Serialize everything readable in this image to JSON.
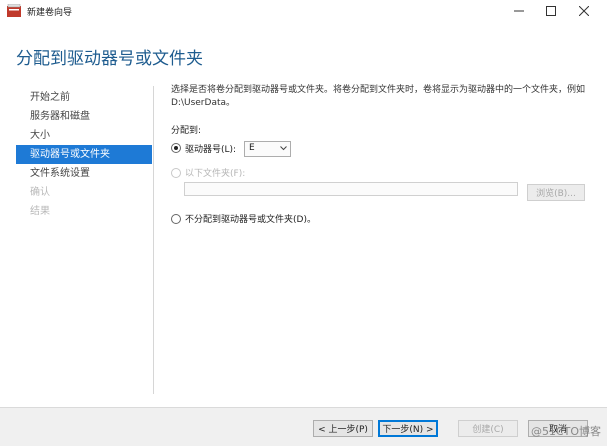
{
  "window": {
    "title": "新建卷向导",
    "controls": [
      "minimize-icon",
      "maximize-icon",
      "close-icon"
    ]
  },
  "heading": "分配到驱动器号或文件夹",
  "nav": {
    "items": [
      {
        "label": "开始之前",
        "state": "normal"
      },
      {
        "label": "服务器和磁盘",
        "state": "normal"
      },
      {
        "label": "大小",
        "state": "normal"
      },
      {
        "label": "驱动器号或文件夹",
        "state": "active"
      },
      {
        "label": "文件系统设置",
        "state": "normal"
      },
      {
        "label": "确认",
        "state": "disabled"
      },
      {
        "label": "结果",
        "state": "disabled"
      }
    ]
  },
  "main": {
    "description": "选择是否将卷分配到驱动器号或文件夹。将卷分配到文件夹时，卷将显示为驱动器中的一个文件夹，例如 D:\\UserData。",
    "assign_label": "分配到:",
    "options": {
      "drive_letter": {
        "label": "驱动器号(L):",
        "checked": true
      },
      "folder": {
        "label": "以下文件夹(F):",
        "checked": false,
        "disabled": true
      },
      "none": {
        "label": "不分配到驱动器号或文件夹(D)。",
        "checked": false
      }
    },
    "drive_select": {
      "value": "E"
    },
    "folder_input": {
      "value": ""
    },
    "browse_button": "浏览(B)..."
  },
  "footer": {
    "prev": "< 上一步(P)",
    "next": "下一步(N) >",
    "create": "创建(C)",
    "cancel": "取消"
  },
  "watermark": "@51CTO博客",
  "colors": {
    "accent": "#1e7ad6",
    "heading": "#1e5c8f",
    "app_icon": "#c0392b"
  }
}
